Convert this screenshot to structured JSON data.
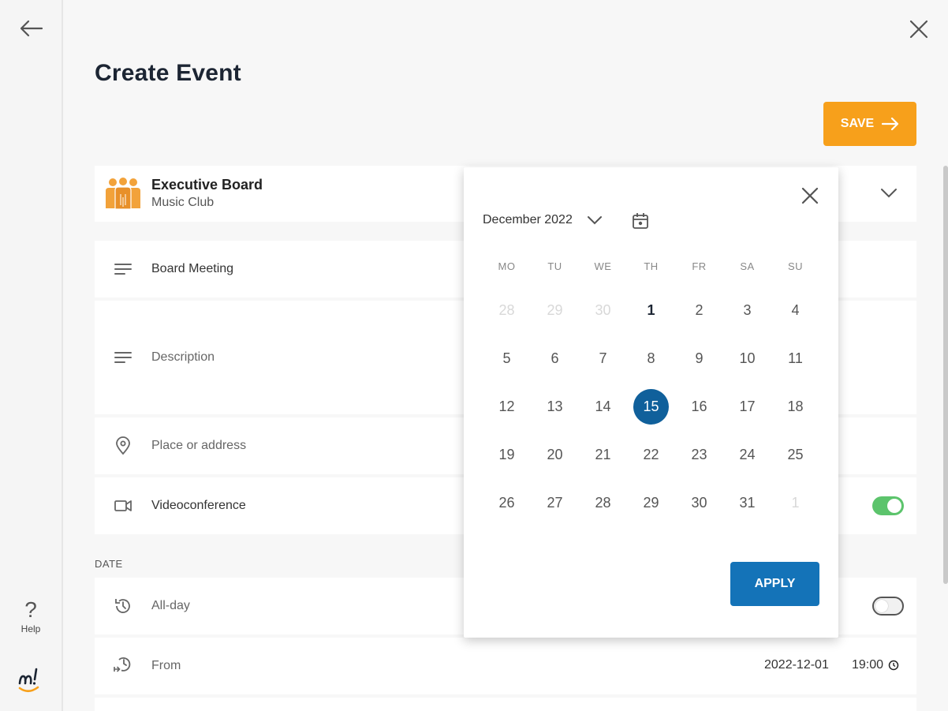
{
  "header": {
    "title": "Create Event",
    "save_label": "SAVE"
  },
  "group": {
    "name": "Executive Board",
    "subtitle": "Music Club"
  },
  "fields": {
    "title_value": "Board Meeting",
    "description_placeholder": "Description",
    "place_placeholder": "Place or address",
    "videoconference_label": "Videoconference",
    "videoconference_on": true
  },
  "date_section": {
    "label": "DATE",
    "allday_label": "All-day",
    "allday_on": false,
    "from_label": "From",
    "from_date": "2022-12-01",
    "from_time": "19:00"
  },
  "sidebar": {
    "help_label": "Help"
  },
  "calendar": {
    "month_label": "December 2022",
    "weekdays": [
      "MO",
      "TU",
      "WE",
      "TH",
      "FR",
      "SA",
      "SU"
    ],
    "weeks": [
      [
        {
          "d": "28",
          "muted": true
        },
        {
          "d": "29",
          "muted": true
        },
        {
          "d": "30",
          "muted": true
        },
        {
          "d": "1",
          "today": true
        },
        {
          "d": "2"
        },
        {
          "d": "3"
        },
        {
          "d": "4"
        }
      ],
      [
        {
          "d": "5"
        },
        {
          "d": "6"
        },
        {
          "d": "7"
        },
        {
          "d": "8"
        },
        {
          "d": "9"
        },
        {
          "d": "10"
        },
        {
          "d": "11"
        }
      ],
      [
        {
          "d": "12"
        },
        {
          "d": "13"
        },
        {
          "d": "14"
        },
        {
          "d": "15",
          "selected": true
        },
        {
          "d": "16"
        },
        {
          "d": "17"
        },
        {
          "d": "18"
        }
      ],
      [
        {
          "d": "19"
        },
        {
          "d": "20"
        },
        {
          "d": "21"
        },
        {
          "d": "22"
        },
        {
          "d": "23"
        },
        {
          "d": "24"
        },
        {
          "d": "25"
        }
      ],
      [
        {
          "d": "26"
        },
        {
          "d": "27"
        },
        {
          "d": "28"
        },
        {
          "d": "29"
        },
        {
          "d": "30"
        },
        {
          "d": "31"
        },
        {
          "d": "1",
          "muted": true
        }
      ]
    ],
    "apply_label": "APPLY"
  },
  "colors": {
    "accent_orange": "#f7a01b",
    "primary_blue": "#1473b8",
    "selected_day": "#10609b",
    "toggle_on": "#5cc46c"
  },
  "icons": {
    "back": "arrow-left-icon",
    "close": "close-icon",
    "save": "arrow-right-icon",
    "group": "group-people-icon",
    "chevron": "chevron-down-icon",
    "text": "text-lines-icon",
    "location": "location-pin-icon",
    "video": "video-camera-icon",
    "history": "history-clock-icon",
    "from": "clock-arrow-icon",
    "calendar": "calendar-today-icon",
    "help": "question-mark-icon",
    "clock": "clock-icon"
  }
}
